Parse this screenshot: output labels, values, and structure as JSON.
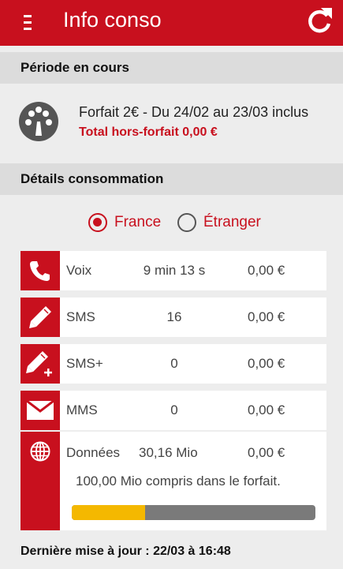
{
  "header": {
    "title": "Info conso"
  },
  "period": {
    "section_title": "Période en cours",
    "plan_text": "Forfait 2€ - Du 24/02 au 23/03 inclus",
    "total_text": "Total hors-forfait  0,00 €"
  },
  "details": {
    "section_title": "Détails consommation",
    "radio": {
      "selected": "France",
      "options": [
        "France",
        "Étranger"
      ]
    },
    "rows": [
      {
        "label": "Voix",
        "quantity": "9 min 13 s",
        "price": "0,00 €",
        "icon": "phone-icon"
      },
      {
        "label": "SMS",
        "quantity": "16",
        "price": "0,00 €",
        "icon": "pencil-icon"
      },
      {
        "label": "SMS+",
        "quantity": "0",
        "price": "0,00 €",
        "icon": "pencil-plus-icon"
      },
      {
        "label": "MMS",
        "quantity": "0",
        "price": "0,00 €",
        "icon": "envelope-icon"
      }
    ],
    "data": {
      "label": "Données",
      "quantity": "30,16 Mio",
      "price": "0,00 €",
      "included_text": "100,00 Mio compris dans le forfait.",
      "usage_fraction": 0.3016,
      "icon": "globe-icon"
    }
  },
  "footer": {
    "last_update": "Dernière mise à jour : 22/03 à 16:48"
  },
  "colors": {
    "brand_red": "#c8101e",
    "progress_fill": "#f4b800",
    "progress_track": "#7a7a7a"
  }
}
